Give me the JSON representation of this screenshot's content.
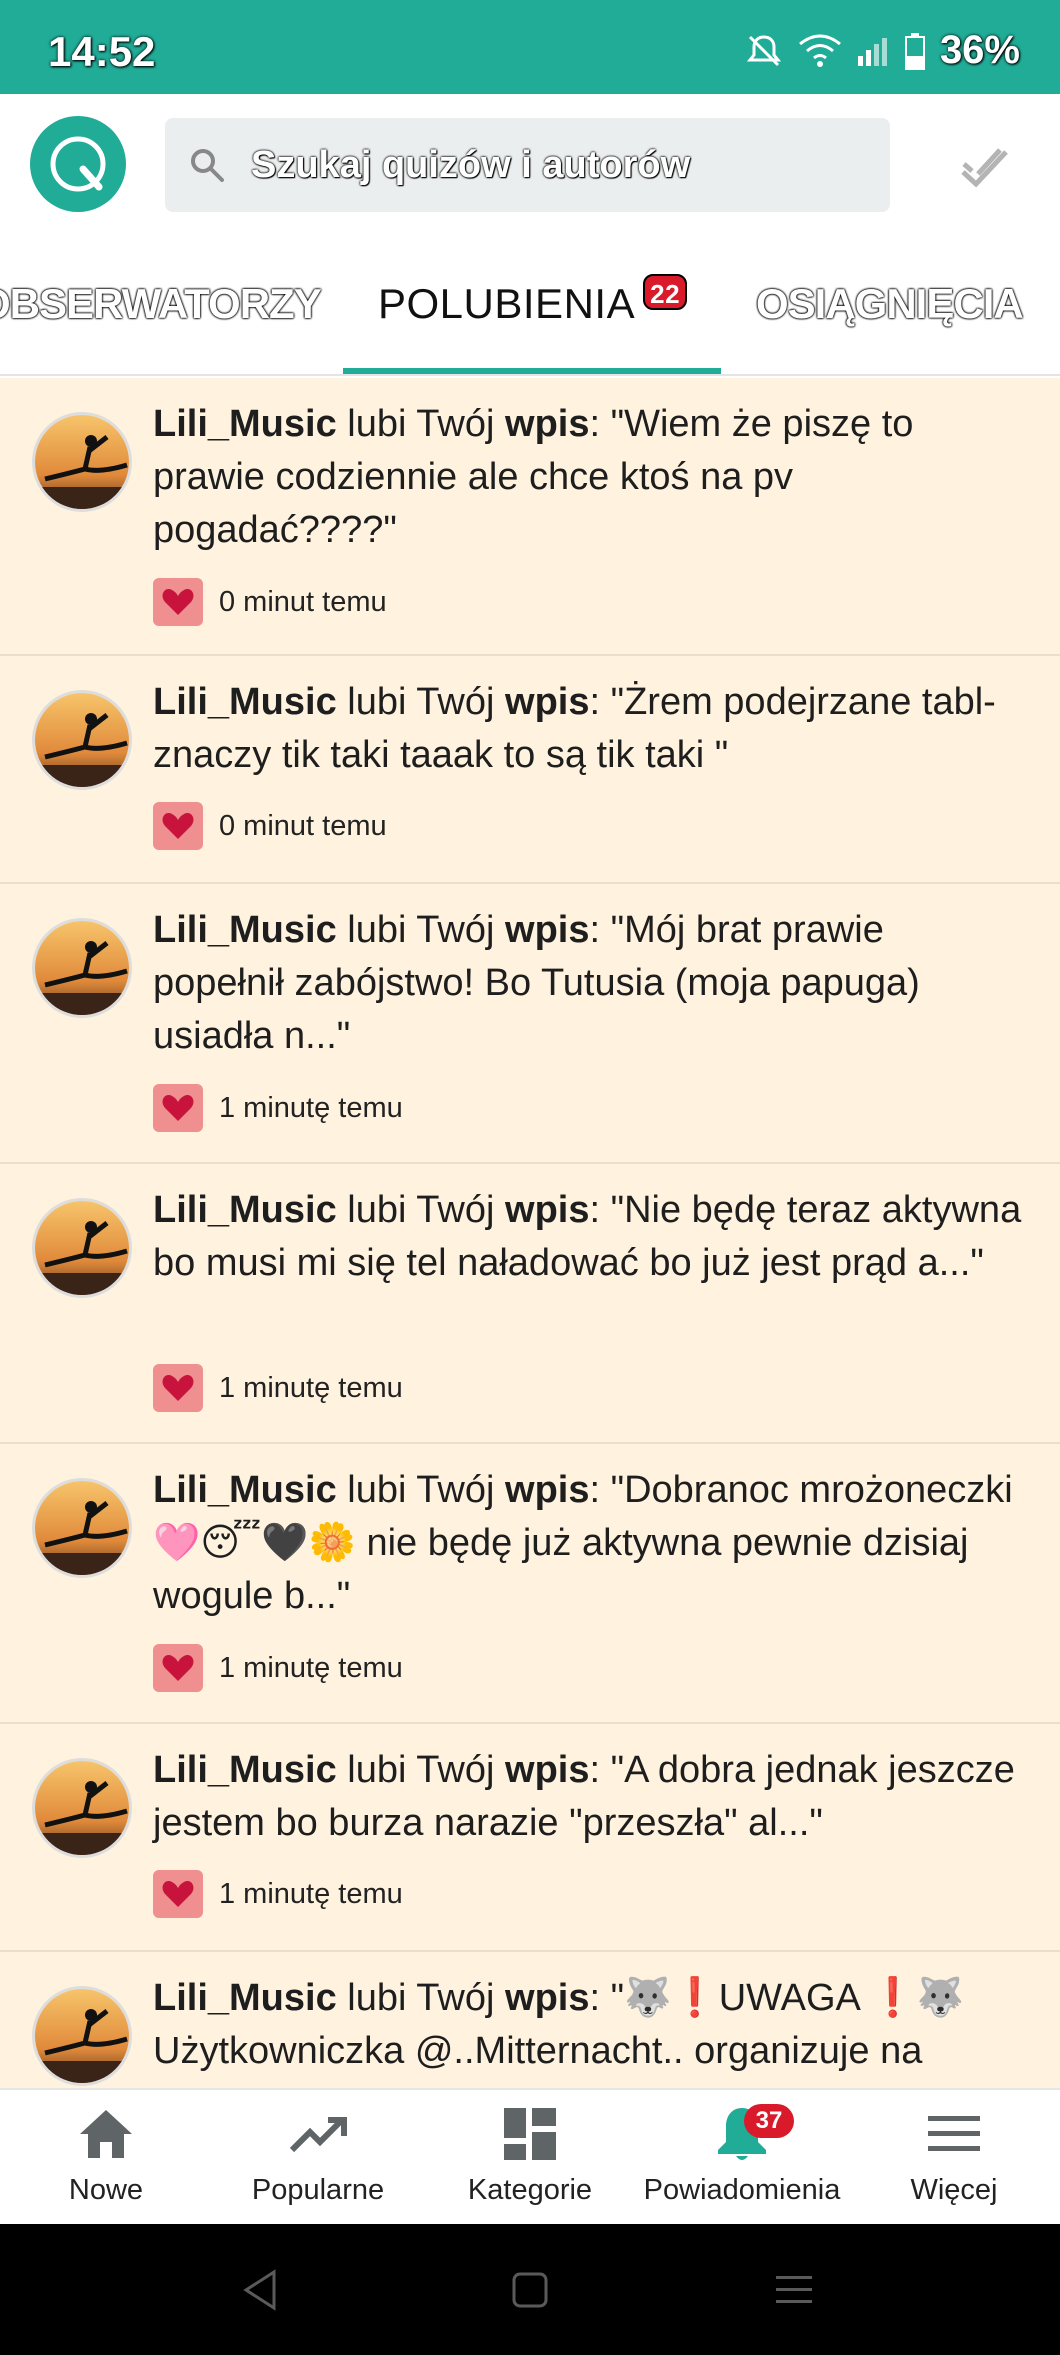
{
  "status_bar": {
    "time": "14:52",
    "battery": "36%",
    "icons": [
      "mute-icon",
      "wifi-icon",
      "signal-icon",
      "battery-icon"
    ]
  },
  "header": {
    "logo_letter": "Q",
    "search_placeholder": "Szukaj quizów i autorów"
  },
  "tabs": [
    {
      "label": "OBSERWATORZY",
      "active": false
    },
    {
      "label": "POLUBIENIA",
      "active": true,
      "badge": "22"
    },
    {
      "label": "OSIĄGNIĘCIA",
      "active": false
    }
  ],
  "notifications": [
    {
      "user": "Lili_Music",
      "action": "lubi Twój",
      "object": "wpis",
      "quote": ": \"Wiem że piszę to prawie codziennie ale chce ktoś na pv pogadać????\"",
      "time": "0 minut temu"
    },
    {
      "user": "Lili_Music",
      "action": "lubi Twój",
      "object": "wpis",
      "quote": ": \"Żrem podejrzane tabl- znaczy tik taki taaak to są tik taki \"",
      "time": "0 minut temu"
    },
    {
      "user": "Lili_Music",
      "action": "lubi Twój",
      "object": "wpis",
      "quote": ": \"Mój brat prawie popełnił zabójstwo! Bo Tutusia (moja papuga) usiadła n...\"",
      "time": "1 minutę temu"
    },
    {
      "user": "Lili_Music",
      "action": "lubi Twój",
      "object": "wpis",
      "quote": ": \"Nie będę teraz aktywna bo musi mi się tel naładować bo już jest prąd a...\"",
      "time": "1 minutę temu"
    },
    {
      "user": "Lili_Music",
      "action": "lubi Twój",
      "object": "wpis",
      "quote": ": \"Dobranoc mrożoneczki 🩷😴🖤🌼 nie będę już aktywna pewnie dzisiaj wogule b...\"",
      "time": "1 minutę temu"
    },
    {
      "user": "Lili_Music",
      "action": "lubi Twój",
      "object": "wpis",
      "quote": ": \"A dobra jednak jeszcze jestem bo burza narazie \"przeszła\" al...\"",
      "time": "1 minutę temu"
    },
    {
      "user": "Lili_Music",
      "action": "lubi Twój",
      "object": "wpis",
      "quote": ": \"🐺❗UWAGA ❗🐺 Użytkowniczka @..Mitternacht.. organizuje na",
      "time": ""
    }
  ],
  "bottom_nav": [
    {
      "label": "Nowe",
      "icon": "home-icon"
    },
    {
      "label": "Popularne",
      "icon": "trending-icon"
    },
    {
      "label": "Kategorie",
      "icon": "categories-icon"
    },
    {
      "label": "Powiadomienia",
      "icon": "bell-icon",
      "badge": "37"
    },
    {
      "label": "Więcej",
      "icon": "menu-icon"
    }
  ],
  "colors": {
    "accent": "#21ac98",
    "item_bg": "#fff3df",
    "badge": "#d91a2a",
    "heart": "#c8143c"
  }
}
